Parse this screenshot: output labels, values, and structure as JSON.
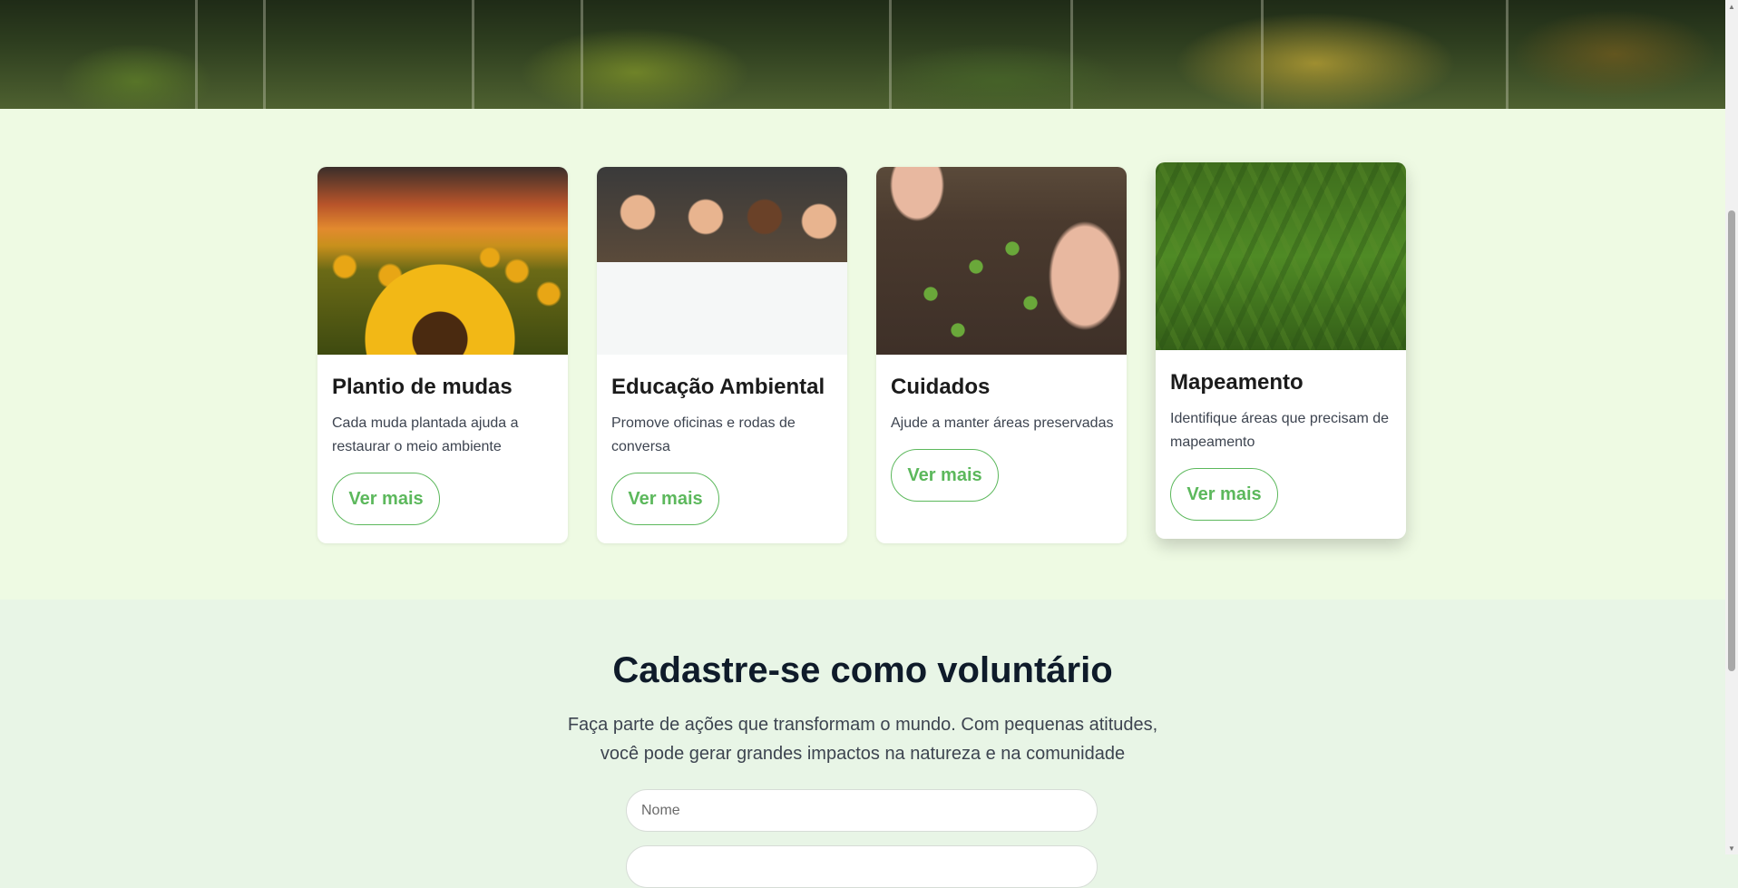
{
  "hero": {
    "image": "forest-canopy-photo"
  },
  "services": {
    "cards": [
      {
        "title": "Plantio de mudas",
        "description": "Cada muda plantada ajuda a restaurar o meio ambiente",
        "button": "Ver mais",
        "image": "sunflower-field-photo"
      },
      {
        "title": "Educação Ambiental",
        "description": "Promove oficinas e rodas de conversa",
        "button": "Ver mais",
        "image": "children-recycling-poster-photo"
      },
      {
        "title": "Cuidados",
        "description": "Ajude a manter áreas preservadas",
        "button": "Ver mais",
        "image": "hands-gardening-soil-photo"
      },
      {
        "title": "Mapeamento",
        "description": "Identifique áreas que precisam de mapeamento",
        "button": "Ver mais",
        "image": "pine-forest-aerial-photo"
      }
    ]
  },
  "volunteer": {
    "title": "Cadastre-se como voluntário",
    "lead": "Faça parte de ações que transformam o mundo. Com pequenas atitudes, você pode gerar grandes impactos na natureza e na comunidade",
    "fields": {
      "name_placeholder": "Nome"
    }
  },
  "colors": {
    "accent": "#5cb85c",
    "services_bg": "#eefae3",
    "volunteer_bg": "#e8f5e6"
  }
}
